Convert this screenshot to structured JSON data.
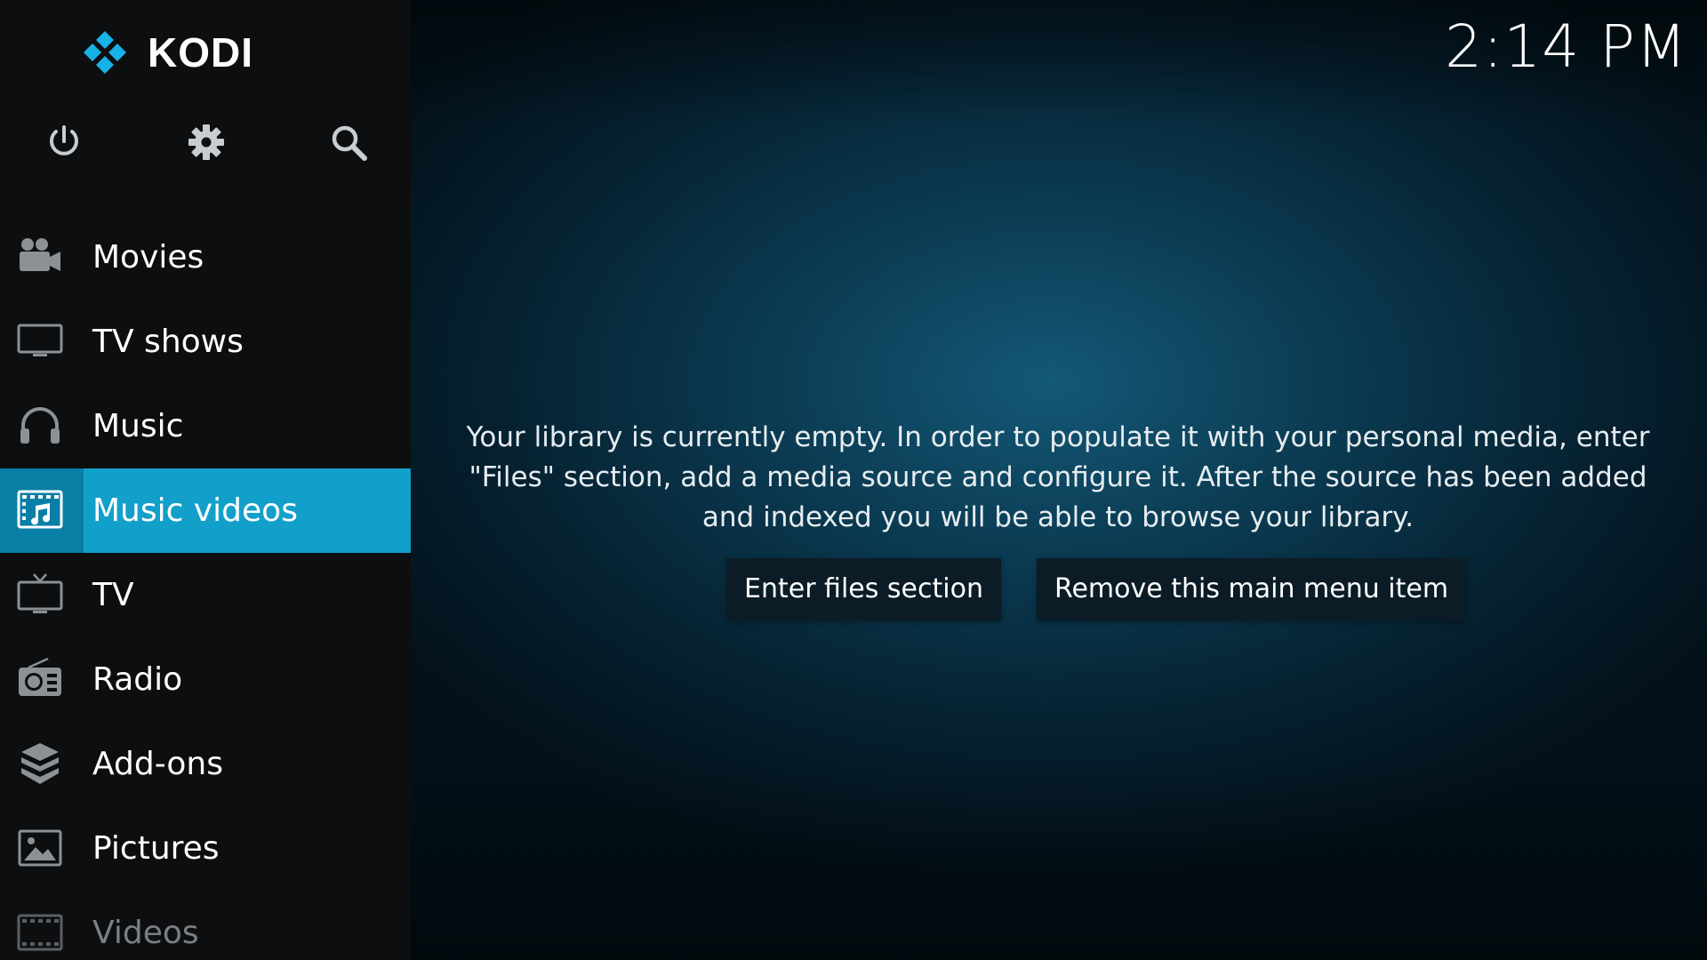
{
  "app": {
    "brand": "KODI"
  },
  "clock": {
    "time": "2:14 PM"
  },
  "top_icons": [
    {
      "name": "power-icon"
    },
    {
      "name": "gear-icon"
    },
    {
      "name": "search-icon"
    }
  ],
  "menu": [
    {
      "id": "movies",
      "label": "Movies",
      "icon": "movie-camera-icon"
    },
    {
      "id": "tv-shows",
      "label": "TV shows",
      "icon": "monitor-icon"
    },
    {
      "id": "music",
      "label": "Music",
      "icon": "headphones-icon"
    },
    {
      "id": "music-videos",
      "label": "Music videos",
      "icon": "music-video-icon",
      "active": true
    },
    {
      "id": "tv",
      "label": "TV",
      "icon": "tv-icon"
    },
    {
      "id": "radio",
      "label": "Radio",
      "icon": "radio-icon"
    },
    {
      "id": "add-ons",
      "label": "Add-ons",
      "icon": "addons-box-icon"
    },
    {
      "id": "pictures",
      "label": "Pictures",
      "icon": "picture-icon"
    },
    {
      "id": "videos",
      "label": "Videos",
      "icon": "film-strip-icon"
    }
  ],
  "content": {
    "message": "Your library is currently empty. In order to populate it with your personal media, enter \"Files\" section, add a media source and configure it. After the source has been added and indexed you will be able to browse your library.",
    "primary_button": "Enter files section",
    "secondary_button": "Remove this main menu item"
  },
  "colors": {
    "sidebar": "#0c0e10",
    "accent": "#12a0cb",
    "accent_dark": "#0a7fa5",
    "button_bg": "#0b1c26",
    "logo_blue": "#17b2e7"
  }
}
